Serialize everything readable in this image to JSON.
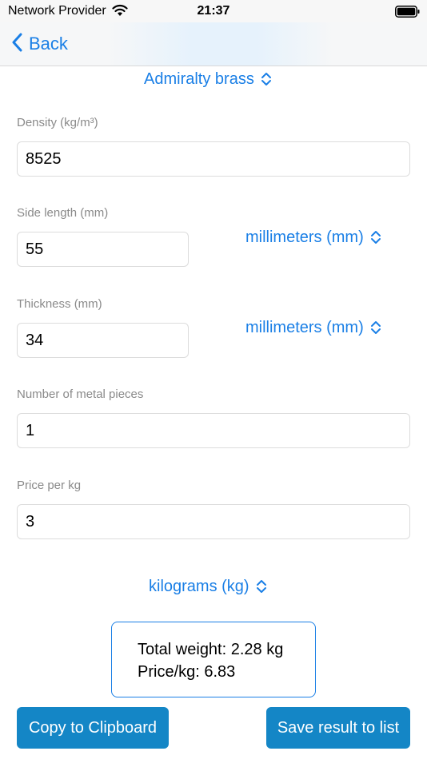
{
  "status_bar": {
    "provider": "Network Provider",
    "time": "21:37"
  },
  "nav": {
    "back_label": "Back"
  },
  "material": {
    "selected": "Admiralty brass"
  },
  "fields": {
    "density": {
      "label": "Density (kg/m³)",
      "value": "8525"
    },
    "side_length": {
      "label": "Side length (mm)",
      "value": "55",
      "unit": "millimeters (mm)"
    },
    "thickness": {
      "label": "Thickness (mm)",
      "value": "34",
      "unit": "millimeters (mm)"
    },
    "pieces": {
      "label": "Number of metal pieces",
      "value": "1"
    },
    "price": {
      "label": "Price per kg",
      "value": "3"
    }
  },
  "weight_unit": {
    "selected": "kilograms (kg)"
  },
  "result": {
    "total_weight": "Total weight: 2.28 kg",
    "price_per_kg": "Price/kg: 6.83"
  },
  "actions": {
    "copy_label": "Copy to Clipboard",
    "save_label": "Save result to list"
  },
  "colors": {
    "accent": "#1a7fe6",
    "button_bg": "#1486c6",
    "label_gray": "#8a8a8a"
  },
  "icons": {
    "wifi": "wifi-icon",
    "battery": "battery-icon",
    "back": "chevron-left-icon",
    "picker": "chevron-up-down-icon"
  }
}
